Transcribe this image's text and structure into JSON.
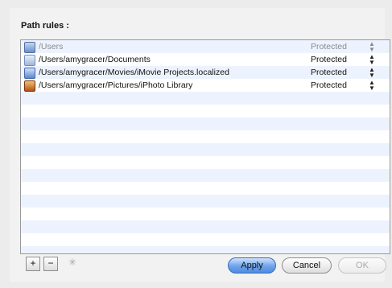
{
  "section_title": "Path rules :",
  "rules": [
    {
      "icon": "users-folder-icon",
      "path": "/Users",
      "status": "Protected",
      "dim": true
    },
    {
      "icon": "documents-folder-icon",
      "path": "/Users/amygracer/Documents",
      "status": "Protected",
      "dim": false
    },
    {
      "icon": "movies-folder-icon",
      "path": "/Users/amygracer/Movies/iMovie Projects.localized",
      "status": "Protected",
      "dim": false
    },
    {
      "icon": "iphoto-library-icon",
      "path": "/Users/amygracer/Pictures/iPhoto Library",
      "status": "Protected",
      "dim": false
    }
  ],
  "buttons": {
    "add": "+",
    "remove": "−",
    "apply": "Apply",
    "cancel": "Cancel",
    "ok": "OK"
  },
  "stepper_glyph": "▲▼",
  "colors": {
    "accent": "#4f8be0",
    "row_alt": "#edf3fe"
  }
}
